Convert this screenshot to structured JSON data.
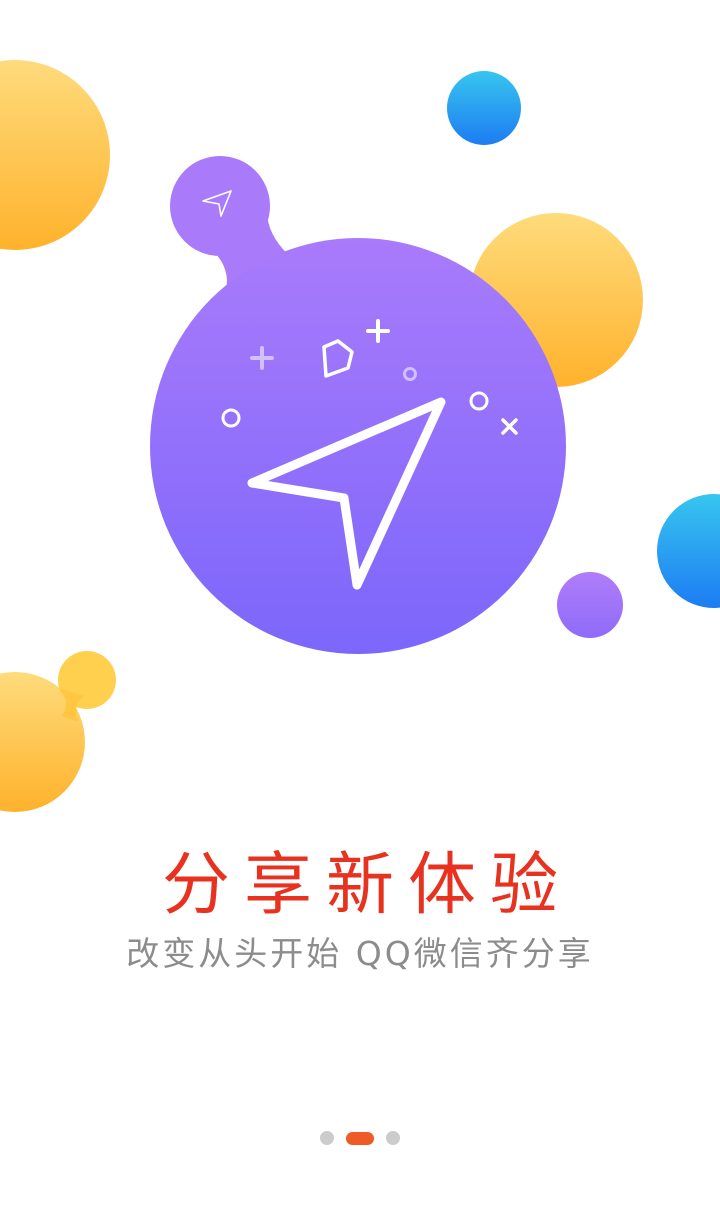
{
  "intro": {
    "headline": "分享新体验",
    "subtitle": "改变从头开始 QQ微信齐分享"
  },
  "illustration": {
    "main_icon": "paper-plane-icon",
    "colors": {
      "purple_light": "#a97bfb",
      "purple_dark": "#7c66fb",
      "yellow_light": "#fedb7c",
      "yellow_dark": "#ffb22c",
      "blue_light": "#37c6ef",
      "blue_dark": "#1d7cf2"
    }
  },
  "pager": {
    "count": 3,
    "active_index": 1,
    "active_color": "#f05a28",
    "inactive_color": "#cccccc"
  }
}
